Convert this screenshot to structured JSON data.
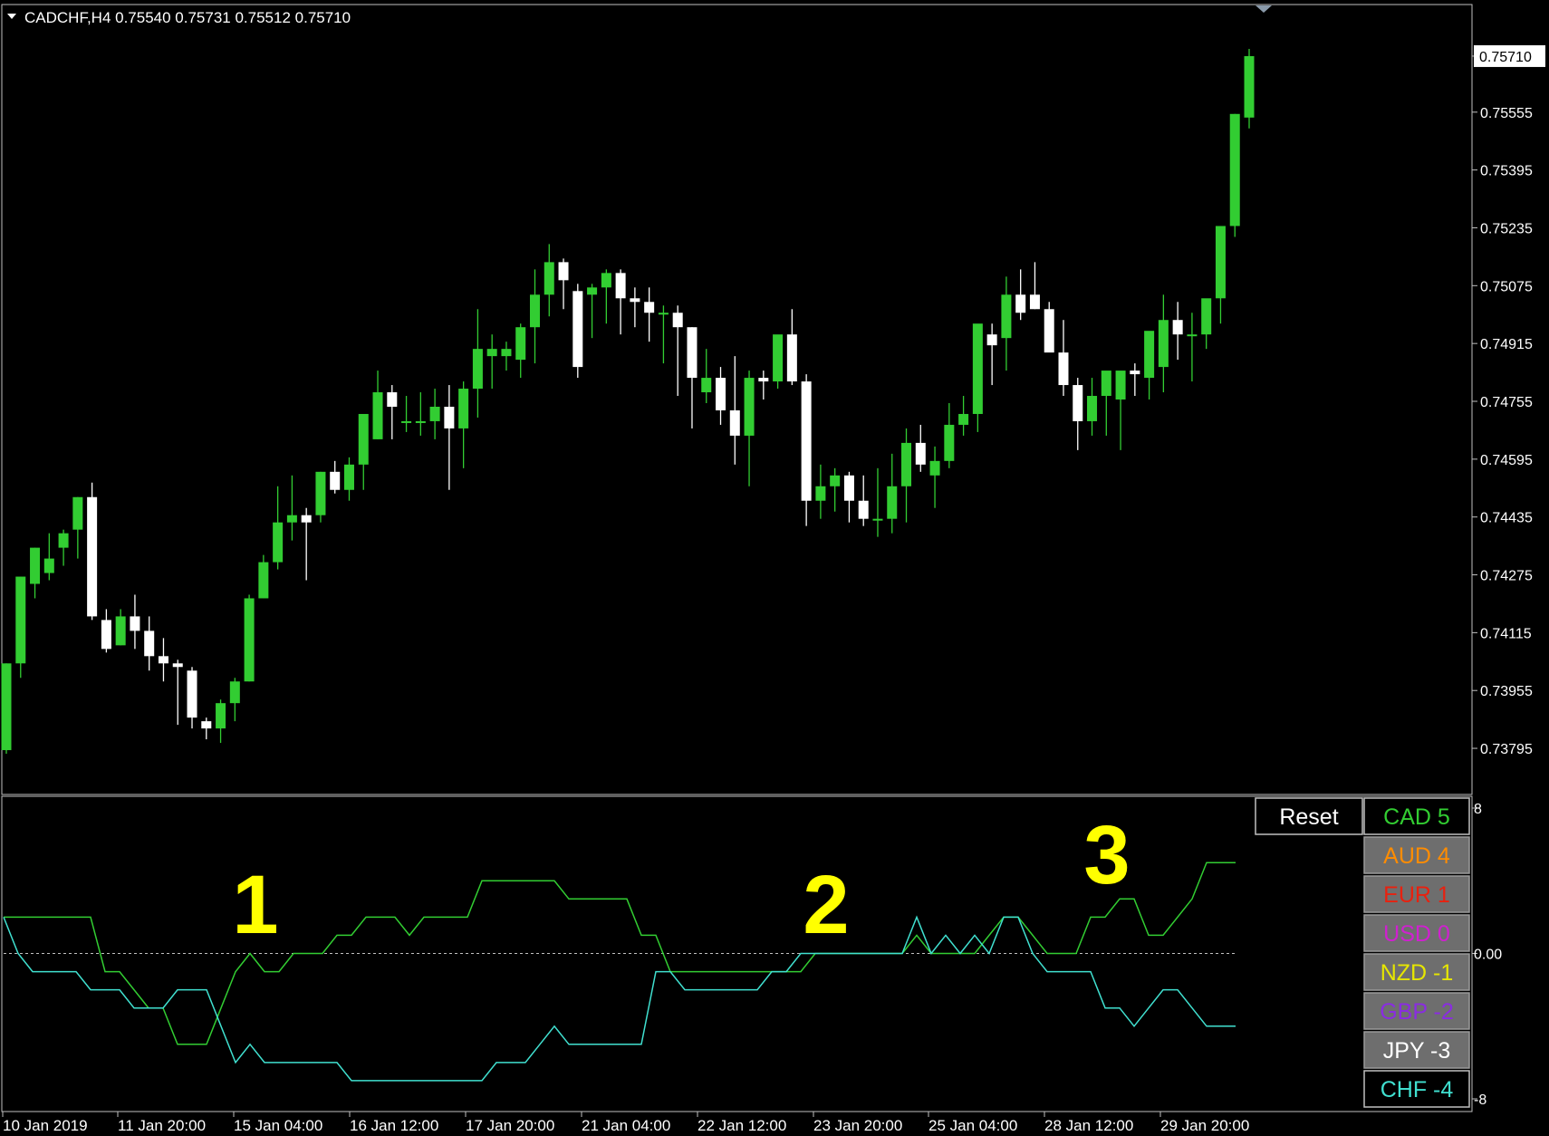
{
  "header": {
    "symbol_text": "CADCHF,H4  0.75540 0.75731 0.75512 0.75710"
  },
  "chart_data": [
    {
      "type": "candlestick",
      "title": "CADCHF,H4",
      "symbol": "CADCHF",
      "timeframe": "H4",
      "ohlc_header": {
        "open": 0.7554,
        "high": 0.75731,
        "low": 0.75512,
        "close": 0.7571
      },
      "current_price_label": "0.75710",
      "y_ticks": [
        "0.75710",
        "0.75555",
        "0.75395",
        "0.75235",
        "0.75075",
        "0.74915",
        "0.74755",
        "0.74595",
        "0.74435",
        "0.74275",
        "0.74115",
        "0.73955",
        "0.73795"
      ],
      "ylim": [
        0.7373,
        0.7577
      ],
      "x_tick_labels": [
        "10 Jan 2019",
        "11 Jan 20:00",
        "15 Jan 04:00",
        "16 Jan 12:00",
        "17 Jan 20:00",
        "21 Jan 04:00",
        "22 Jan 12:00",
        "23 Jan 20:00",
        "25 Jan 04:00",
        "28 Jan 12:00",
        "29 Jan 20:00"
      ],
      "colors": {
        "bull": "#32cd32",
        "bear": "#ffffff",
        "background": "#000000"
      },
      "candles": [
        [
          0.7379,
          0.7403,
          0.7378,
          0.7403
        ],
        [
          0.7403,
          0.7427,
          0.7399,
          0.7427
        ],
        [
          0.7425,
          0.7435,
          0.7421,
          0.7435
        ],
        [
          0.7428,
          0.7439,
          0.7426,
          0.7432
        ],
        [
          0.7435,
          0.744,
          0.743,
          0.7439
        ],
        [
          0.744,
          0.7449,
          0.7432,
          0.7449
        ],
        [
          0.7449,
          0.7453,
          0.7415,
          0.7416
        ],
        [
          0.7415,
          0.7418,
          0.7406,
          0.7407
        ],
        [
          0.7408,
          0.7418,
          0.7408,
          0.7416
        ],
        [
          0.7416,
          0.7422,
          0.7407,
          0.7412
        ],
        [
          0.7412,
          0.7416,
          0.7401,
          0.7405
        ],
        [
          0.7405,
          0.741,
          0.7398,
          0.7403
        ],
        [
          0.7403,
          0.7404,
          0.7386,
          0.7402
        ],
        [
          0.7401,
          0.7402,
          0.7385,
          0.7388
        ],
        [
          0.7387,
          0.7388,
          0.7382,
          0.7385
        ],
        [
          0.7385,
          0.7393,
          0.7381,
          0.7392
        ],
        [
          0.7392,
          0.7399,
          0.7387,
          0.7398
        ],
        [
          0.7398,
          0.7422,
          0.7398,
          0.7421
        ],
        [
          0.7421,
          0.7433,
          0.7421,
          0.7431
        ],
        [
          0.7431,
          0.7452,
          0.7429,
          0.7442
        ],
        [
          0.7442,
          0.7455,
          0.7437,
          0.7444
        ],
        [
          0.7444,
          0.7446,
          0.7426,
          0.7442
        ],
        [
          0.7444,
          0.7456,
          0.7442,
          0.7456
        ],
        [
          0.7456,
          0.7459,
          0.745,
          0.7451
        ],
        [
          0.7451,
          0.746,
          0.7448,
          0.7458
        ],
        [
          0.7458,
          0.7464,
          0.7451,
          0.7472
        ],
        [
          0.7465,
          0.7484,
          0.7465,
          0.7478
        ],
        [
          0.7478,
          0.748,
          0.7465,
          0.7474
        ],
        [
          0.747,
          0.7477,
          0.7467,
          0.747
        ],
        [
          0.747,
          0.7478,
          0.7466,
          0.747
        ],
        [
          0.747,
          0.7479,
          0.7465,
          0.7474
        ],
        [
          0.7474,
          0.748,
          0.7451,
          0.7468
        ],
        [
          0.7468,
          0.7481,
          0.7457,
          0.7479
        ],
        [
          0.7479,
          0.7501,
          0.7471,
          0.749
        ],
        [
          0.7488,
          0.7494,
          0.7479,
          0.749
        ],
        [
          0.7488,
          0.7492,
          0.7484,
          0.749
        ],
        [
          0.7487,
          0.7497,
          0.7482,
          0.7496
        ],
        [
          0.7496,
          0.7512,
          0.7486,
          0.7505
        ],
        [
          0.7505,
          0.7519,
          0.7499,
          0.7514
        ],
        [
          0.7514,
          0.7515,
          0.7501,
          0.7509
        ],
        [
          0.7506,
          0.7508,
          0.7482,
          0.7485
        ],
        [
          0.7505,
          0.7508,
          0.7493,
          0.7507
        ],
        [
          0.7507,
          0.7512,
          0.7497,
          0.7511
        ],
        [
          0.7511,
          0.7512,
          0.7494,
          0.7504
        ],
        [
          0.7504,
          0.7507,
          0.7496,
          0.7503
        ],
        [
          0.7503,
          0.7507,
          0.7492,
          0.75
        ],
        [
          0.75,
          0.7502,
          0.7486,
          0.75
        ],
        [
          0.75,
          0.7502,
          0.7477,
          0.7496
        ],
        [
          0.7496,
          0.7496,
          0.7468,
          0.7482
        ],
        [
          0.7478,
          0.749,
          0.7475,
          0.7482
        ],
        [
          0.7482,
          0.7485,
          0.7469,
          0.7473
        ],
        [
          0.7473,
          0.7488,
          0.7458,
          0.7466
        ],
        [
          0.7466,
          0.7484,
          0.7452,
          0.7482
        ],
        [
          0.7482,
          0.7484,
          0.7476,
          0.7481
        ],
        [
          0.7481,
          0.7492,
          0.7479,
          0.7494
        ],
        [
          0.7494,
          0.7501,
          0.748,
          0.7481
        ],
        [
          0.7481,
          0.7483,
          0.7441,
          0.7448
        ],
        [
          0.7448,
          0.7458,
          0.7443,
          0.7452
        ],
        [
          0.7452,
          0.7457,
          0.7445,
          0.7455
        ],
        [
          0.7455,
          0.7456,
          0.7442,
          0.7448
        ],
        [
          0.7448,
          0.7455,
          0.7441,
          0.7443
        ],
        [
          0.7443,
          0.7457,
          0.7438,
          0.7443
        ],
        [
          0.7443,
          0.7461,
          0.7439,
          0.7452
        ],
        [
          0.7452,
          0.7468,
          0.7442,
          0.7464
        ],
        [
          0.7464,
          0.7469,
          0.7456,
          0.7458
        ],
        [
          0.7455,
          0.7463,
          0.7446,
          0.7459
        ],
        [
          0.7459,
          0.7475,
          0.7457,
          0.7469
        ],
        [
          0.7469,
          0.7477,
          0.7466,
          0.7472
        ],
        [
          0.7472,
          0.7492,
          0.7467,
          0.7497
        ],
        [
          0.7494,
          0.7497,
          0.748,
          0.7491
        ],
        [
          0.7493,
          0.751,
          0.7484,
          0.7505
        ],
        [
          0.7505,
          0.7512,
          0.7498,
          0.75
        ],
        [
          0.7505,
          0.7514,
          0.7501,
          0.7501
        ],
        [
          0.7501,
          0.7503,
          0.7494,
          0.7489
        ],
        [
          0.7489,
          0.7498,
          0.7477,
          0.748
        ],
        [
          0.748,
          0.7482,
          0.7462,
          0.747
        ],
        [
          0.747,
          0.7482,
          0.7466,
          0.7477
        ],
        [
          0.7477,
          0.7482,
          0.7466,
          0.7484
        ],
        [
          0.7476,
          0.748,
          0.7462,
          0.7484
        ],
        [
          0.7484,
          0.7486,
          0.7477,
          0.7483
        ],
        [
          0.7482,
          0.7484,
          0.7476,
          0.7495
        ],
        [
          0.7485,
          0.7505,
          0.7478,
          0.7498
        ],
        [
          0.7498,
          0.7503,
          0.7487,
          0.7494
        ],
        [
          0.7494,
          0.75,
          0.7481,
          0.7494
        ],
        [
          0.7494,
          0.7497,
          0.749,
          0.7504
        ],
        [
          0.7504,
          0.7524,
          0.7497,
          0.7524
        ],
        [
          0.7524,
          0.7555,
          0.7521,
          0.7555
        ],
        [
          0.7554,
          0.7573,
          0.7551,
          0.7571
        ]
      ]
    },
    {
      "type": "line",
      "title": "Currency strength",
      "ylim": [
        -8,
        8
      ],
      "y_ticks": [
        "8",
        "0.00",
        "-8"
      ],
      "zero_line": true,
      "x": [
        0,
        1,
        2,
        3,
        4,
        5,
        6,
        7,
        8,
        9,
        10,
        11,
        12,
        13,
        14,
        15,
        16,
        17,
        18,
        19,
        20,
        21,
        22,
        23,
        24,
        25,
        26,
        27,
        28,
        29,
        30,
        31,
        32,
        33,
        34,
        35,
        36,
        37,
        38,
        39,
        40,
        41,
        42,
        43,
        44,
        45,
        46,
        47,
        48,
        49,
        50,
        51,
        52,
        53,
        54,
        55,
        56,
        57,
        58,
        59,
        60,
        61,
        62,
        63,
        64,
        65,
        66,
        67,
        68,
        69,
        70,
        71,
        72,
        73,
        74,
        75,
        76,
        77,
        78,
        79,
        80,
        81,
        82,
        83,
        84,
        85
      ],
      "series": [
        {
          "name": "CAD",
          "color": "#32cd32",
          "values": [
            2,
            2,
            2,
            2,
            2,
            2,
            2,
            -1,
            -1,
            -2,
            -3,
            -3,
            -5,
            -5,
            -5,
            -3,
            -1,
            0,
            -1,
            -1,
            0,
            0,
            0,
            1,
            1,
            2,
            2,
            2,
            1,
            2,
            2,
            2,
            2,
            4,
            4,
            4,
            4,
            4,
            4,
            3,
            3,
            3,
            3,
            3,
            1,
            1,
            -1,
            -1,
            -1,
            -1,
            -1,
            -1,
            -1,
            -1,
            -1,
            -1,
            0,
            0,
            0,
            0,
            0,
            0,
            0,
            1,
            0,
            0,
            0,
            0,
            1,
            2,
            2,
            1,
            0,
            0,
            0,
            2,
            2,
            3,
            3,
            1,
            1,
            2,
            3,
            5,
            5,
            5
          ]
        },
        {
          "name": "CHF",
          "color": "#40e0d0",
          "values": [
            2,
            0,
            -1,
            -1,
            -1,
            -1,
            -2,
            -2,
            -2,
            -3,
            -3,
            -3,
            -2,
            -2,
            -2,
            -4,
            -6,
            -5,
            -6,
            -6,
            -6,
            -6,
            -6,
            -6,
            -7,
            -7,
            -7,
            -7,
            -7,
            -7,
            -7,
            -7,
            -7,
            -7,
            -6,
            -6,
            -6,
            -5,
            -4,
            -5,
            -5,
            -5,
            -5,
            -5,
            -5,
            -1,
            -1,
            -2,
            -2,
            -2,
            -2,
            -2,
            -2,
            -1,
            -1,
            0,
            0,
            0,
            0,
            0,
            0,
            0,
            0,
            2,
            0,
            1,
            0,
            1,
            0,
            2,
            2,
            0,
            -1,
            -1,
            -1,
            -1,
            -3,
            -3,
            -4,
            -3,
            -2,
            -2,
            -3,
            -4,
            -4,
            -4
          ]
        }
      ],
      "annotations": [
        {
          "text": "1",
          "color": "#ffff00"
        },
        {
          "text": "2",
          "color": "#ffff00"
        },
        {
          "text": "3",
          "color": "#ffff00"
        }
      ]
    }
  ],
  "panel": {
    "reset_label": "Reset",
    "currencies": [
      {
        "label": "CAD 5",
        "color": "#32cd32",
        "selected": true
      },
      {
        "label": "AUD 4",
        "color": "#ff8c00",
        "selected": false
      },
      {
        "label": "EUR 1",
        "color": "#e8210f",
        "selected": false
      },
      {
        "label": "USD 0",
        "color": "#d020d0",
        "selected": false
      },
      {
        "label": "NZD -1",
        "color": "#e6e600",
        "selected": false
      },
      {
        "label": "GBP -2",
        "color": "#8a2be2",
        "selected": false
      },
      {
        "label": "JPY -3",
        "color": "#ffffff",
        "selected": false
      },
      {
        "label": "CHF -4",
        "color": "#40e0d0",
        "selected": true
      }
    ]
  }
}
